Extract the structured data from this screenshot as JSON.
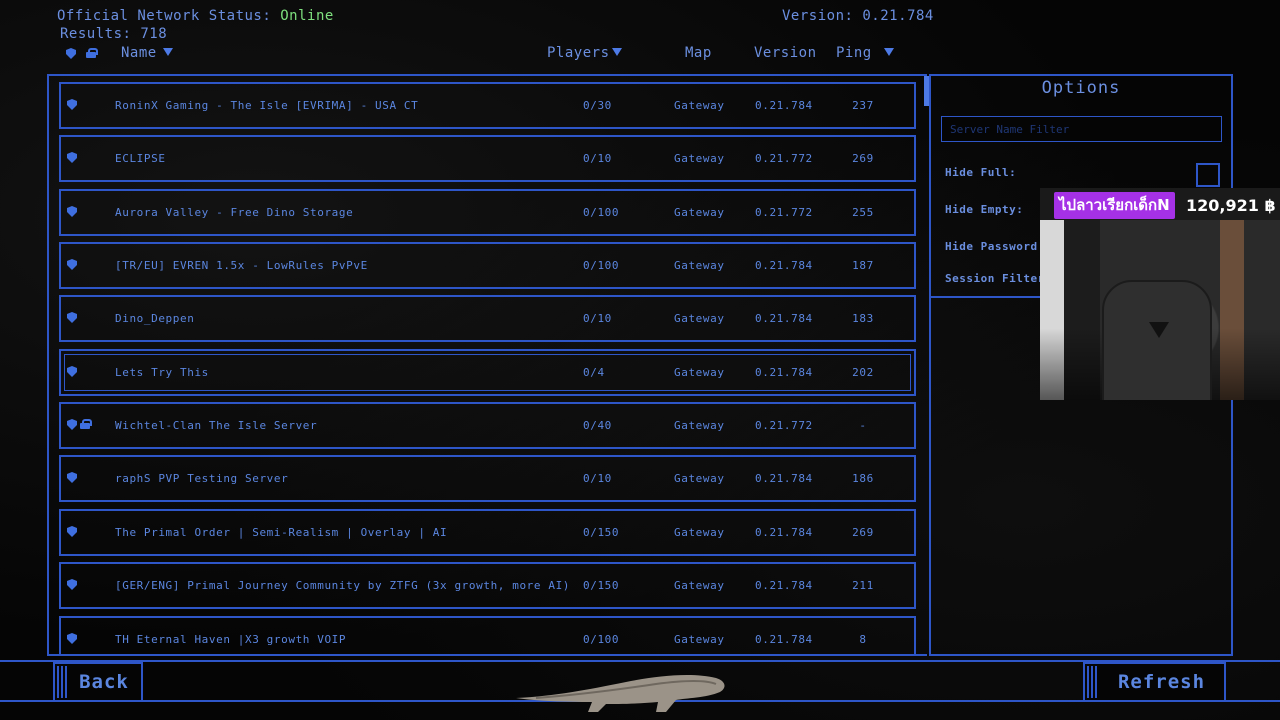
{
  "status": {
    "label": "Official Network Status:",
    "value": "Online"
  },
  "results": {
    "label": "Results:",
    "count": "718"
  },
  "version": {
    "label": "Version:",
    "value": "0.21.784"
  },
  "columns": {
    "name": "Name",
    "players": "Players",
    "map": "Map",
    "version": "Version",
    "ping": "Ping"
  },
  "servers": [
    {
      "name": "RoninX Gaming - The Isle [EVRIMA] - USA CT",
      "players": "0/30",
      "map": "Gateway",
      "version": "0.21.784",
      "ping": "237",
      "locked": false
    },
    {
      "name": "ECLIPSE",
      "players": "0/10",
      "map": "Gateway",
      "version": "0.21.772",
      "ping": "269",
      "locked": false
    },
    {
      "name": "Aurora Valley - Free Dino Storage",
      "players": "0/100",
      "map": "Gateway",
      "version": "0.21.772",
      "ping": "255",
      "locked": false
    },
    {
      "name": "[TR/EU] EVREN 1.5x - LowRules PvPvE",
      "players": "0/100",
      "map": "Gateway",
      "version": "0.21.784",
      "ping": "187",
      "locked": false
    },
    {
      "name": "Dino_Deppen",
      "players": "0/10",
      "map": "Gateway",
      "version": "0.21.784",
      "ping": "183",
      "locked": false
    },
    {
      "name": "Lets Try This",
      "players": "0/4",
      "map": "Gateway",
      "version": "0.21.784",
      "ping": "202",
      "locked": false
    },
    {
      "name": "Wichtel-Clan The Isle Server",
      "players": "0/40",
      "map": "Gateway",
      "version": "0.21.772",
      "ping": "-",
      "locked": true
    },
    {
      "name": "raphS PVP Testing Server",
      "players": "0/10",
      "map": "Gateway",
      "version": "0.21.784",
      "ping": "186",
      "locked": false
    },
    {
      "name": "The Primal Order | Semi-Realism | Overlay | AI",
      "players": "0/150",
      "map": "Gateway",
      "version": "0.21.784",
      "ping": "269",
      "locked": false
    },
    {
      "name": "[GER/ENG] Primal Journey Community by ZTFG (3x growth, more AI)",
      "players": "0/150",
      "map": "Gateway",
      "version": "0.21.784",
      "ping": "211",
      "locked": false
    },
    {
      "name": "TH Eternal Haven |X3 growth VOIP",
      "players": "0/100",
      "map": "Gateway",
      "version": "0.21.784",
      "ping": "8",
      "locked": false
    }
  ],
  "selected_row": 5,
  "options": {
    "title": "Options",
    "filter_placeholder": "Server Name Filter",
    "hide_full": "Hide Full:",
    "hide_empty": "Hide Empty:",
    "hide_password": "Hide Password P",
    "session_filter": "Session Filter"
  },
  "stream_overlay": {
    "donor": "ไปลาวเรียกเด็กN",
    "amount": "120,921 ฿"
  },
  "buttons": {
    "back": "Back",
    "refresh": "Refresh"
  },
  "colors": {
    "accent": "#2e56c8",
    "text": "#5b86e0",
    "online": "#7ee07e",
    "donor_tag": "#a531e6"
  }
}
